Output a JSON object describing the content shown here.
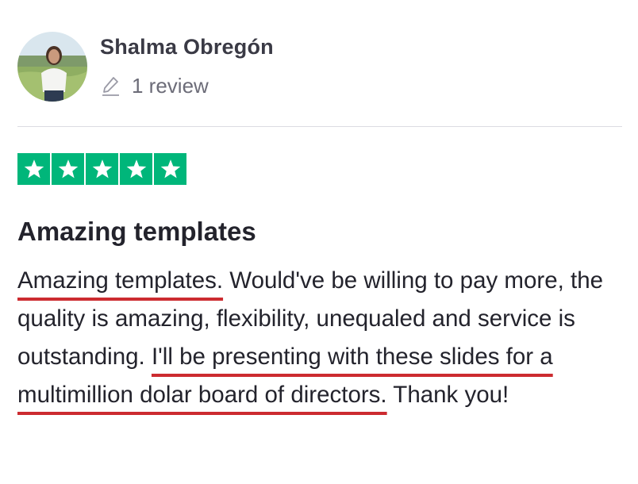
{
  "reviewer": {
    "name": "Shalma Obregón",
    "review_count": "1 review"
  },
  "rating": {
    "stars": 5,
    "max_stars": 5,
    "color": "#00b67a"
  },
  "review": {
    "title": "Amazing templates",
    "segments": [
      {
        "text": "Amazing templates.",
        "highlighted": true
      },
      {
        "text": " Would've be willing to pay more, the quality is amazing, flexibility, unequaled and service is outstanding. ",
        "highlighted": false
      },
      {
        "text": "I'll be presenting with these slides for a multimillion dolar board of directors.",
        "highlighted": true
      },
      {
        "text": " Thank you!",
        "highlighted": false
      }
    ]
  },
  "colors": {
    "highlight_underline": "#cc2b30",
    "star_green": "#00b67a"
  },
  "icons": {
    "pencil": "pencil-icon",
    "star": "star-icon",
    "avatar": "avatar"
  }
}
